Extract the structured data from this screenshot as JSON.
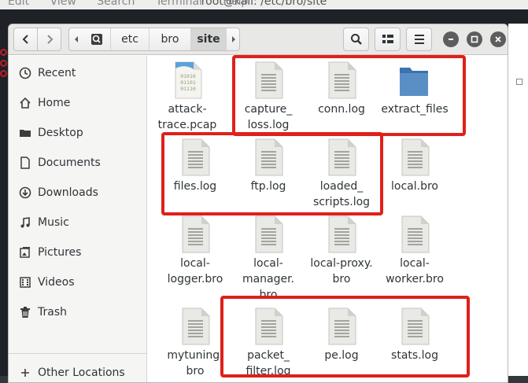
{
  "terminal": {
    "title": "root@kali: /etc/bro/site",
    "menu": [
      "Edit",
      "View",
      "Search",
      "Terminal",
      "Help"
    ]
  },
  "nav": {
    "back_icon": "chevron-left-icon",
    "forward_icon": "chevron-right-icon"
  },
  "pathbar": {
    "segments": [
      "etc",
      "bro",
      "site"
    ],
    "active": "site"
  },
  "sidebar": {
    "items": [
      {
        "label": "Recent",
        "icon": "clock-icon"
      },
      {
        "label": "Home",
        "icon": "home-icon"
      },
      {
        "label": "Desktop",
        "icon": "desktop-icon"
      },
      {
        "label": "Documents",
        "icon": "document-icon"
      },
      {
        "label": "Downloads",
        "icon": "download-icon"
      },
      {
        "label": "Music",
        "icon": "music-icon"
      },
      {
        "label": "Pictures",
        "icon": "picture-icon"
      },
      {
        "label": "Videos",
        "icon": "video-icon"
      },
      {
        "label": "Trash",
        "icon": "trash-icon"
      },
      {
        "label": "Other Locations",
        "icon": "plus-icon"
      }
    ]
  },
  "files": [
    {
      "name": "attack-\ntrace.pcap",
      "type": "binary"
    },
    {
      "name": "capture_\nloss.log",
      "type": "text"
    },
    {
      "name": "conn.log",
      "type": "text"
    },
    {
      "name": "extract_files",
      "type": "folder"
    },
    {
      "name": "files.log",
      "type": "text"
    },
    {
      "name": "ftp.log",
      "type": "text"
    },
    {
      "name": "loaded_\nscripts.log",
      "type": "text"
    },
    {
      "name": "local.bro",
      "type": "text"
    },
    {
      "name": "local-\nlogger.bro",
      "type": "text"
    },
    {
      "name": "local-\nmanager.\nbro",
      "type": "text"
    },
    {
      "name": "local-proxy.\nbro",
      "type": "text"
    },
    {
      "name": "local-\nworker.bro",
      "type": "text"
    },
    {
      "name": "mytuning.\nbro",
      "type": "text"
    },
    {
      "name": "packet_\nfilter.log",
      "type": "text"
    },
    {
      "name": "pe.log",
      "type": "text"
    },
    {
      "name": "stats.log",
      "type": "text"
    }
  ],
  "colors": {
    "highlight": "#e0201a",
    "folder": "#5a8fc6"
  }
}
